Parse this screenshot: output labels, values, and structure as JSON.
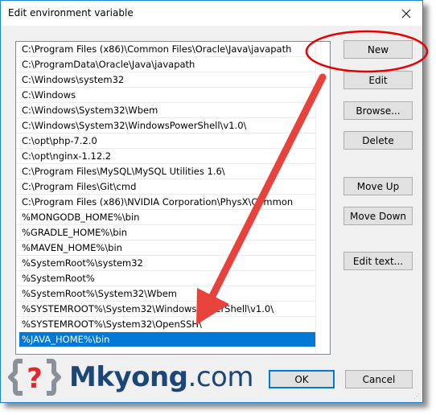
{
  "window": {
    "title": "Edit environment variable",
    "close_icon": "close-icon"
  },
  "path_list": {
    "items": [
      "C:\\Program Files (x86)\\Common Files\\Oracle\\Java\\javapath",
      "C:\\ProgramData\\Oracle\\Java\\javapath",
      "C:\\Windows\\system32",
      "C:\\Windows",
      "C:\\Windows\\System32\\Wbem",
      "C:\\Windows\\System32\\WindowsPowerShell\\v1.0\\",
      "C:\\opt\\php-7.2.0",
      "C:\\opt\\nginx-1.12.2",
      "C:\\Program Files\\MySQL\\MySQL Utilities 1.6\\",
      "C:\\Program Files\\Git\\cmd",
      "C:\\Program Files (x86)\\NVIDIA Corporation\\PhysX\\Common",
      "%MONGODB_HOME%\\bin",
      "%GRADLE_HOME%\\bin",
      "%MAVEN_HOME%\\bin",
      "%SystemRoot%\\system32",
      "%SystemRoot%",
      "%SystemRoot%\\System32\\Wbem",
      "%SYSTEMROOT%\\System32\\WindowsPowerShell\\v1.0\\",
      "%SYSTEMROOT%\\System32\\OpenSSH\\",
      "%JAVA_HOME%\\bin"
    ],
    "selected_index": 19
  },
  "buttons": {
    "new": "New",
    "edit": "Edit",
    "browse": "Browse...",
    "delete": "Delete",
    "move_up": "Move Up",
    "move_down": "Move Down",
    "edit_text": "Edit text...",
    "ok": "OK",
    "cancel": "Cancel"
  },
  "watermark": {
    "brand_bold": "Mkyong",
    "brand_suffix": ".com",
    "logo_icon": "question-braces-logo-icon"
  },
  "annotations": {
    "highlight_target": "New",
    "arrow_target": "%JAVA_HOME%\\bin",
    "color": "#e8423c",
    "circle_color": "#e60000"
  },
  "colors": {
    "selection": "#0078d7",
    "brand": "#1b4677",
    "logo_red": "#e5262c",
    "logo_gray": "#8a9099"
  }
}
